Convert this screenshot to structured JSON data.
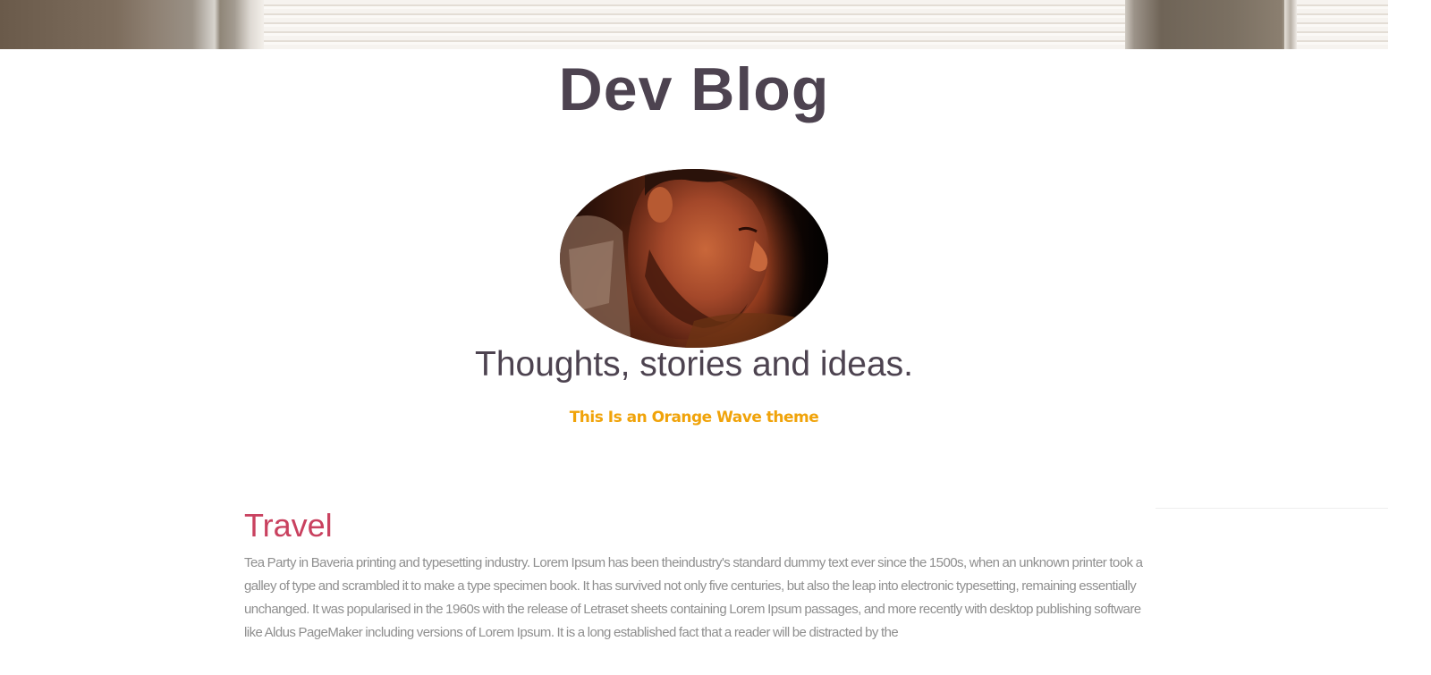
{
  "header": {
    "title": "Dev Blog"
  },
  "hero": {
    "avatar_alt": "Author portrait",
    "tagline": "Thoughts, stories and ideas.",
    "theme_note": "This Is an Orange Wave theme"
  },
  "posts": [
    {
      "title": "Travel",
      "excerpt": "Tea Party in Baveria printing and typesetting industry. Lorem Ipsum has been theindustry's standard dummy text ever since the 1500s, when an unknown printer took a galley of type and scrambled it to make a type specimen book. It has survived not only five centuries, but also the leap into electronic typesetting, remaining essentially unchanged. It was popularised in the 1960s with the release of Letraset sheets containing Lorem Ipsum passages, and more recently with desktop publishing software like Aldus PageMaker including versions of Lorem Ipsum. It is a long established fact that a reader will be distracted by the"
    }
  ],
  "colors": {
    "title": "#4d4350",
    "accent_orange": "#f0a30a",
    "post_title": "#c9415f",
    "body_text": "#8f8f8f"
  }
}
